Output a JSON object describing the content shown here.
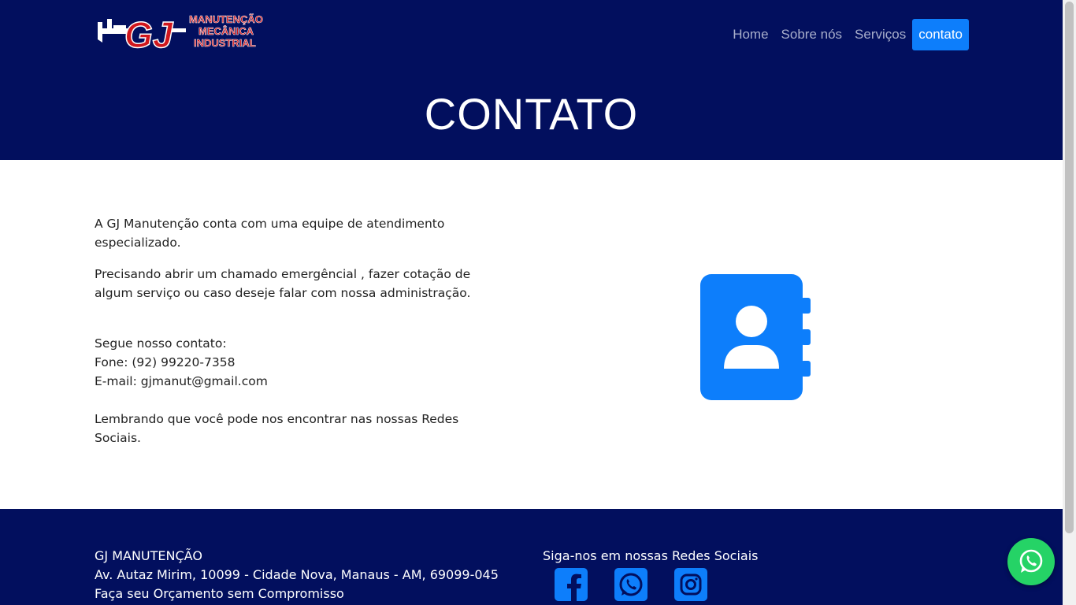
{
  "logo": {
    "initials": "GJ",
    "line1": "MANUTENÇÃO",
    "line2": "MECÂNICA",
    "line3": "INDUSTRIAL"
  },
  "nav": {
    "items": [
      {
        "label": "Home"
      },
      {
        "label": "Sobre nós"
      },
      {
        "label": "Serviços"
      },
      {
        "label": "contato"
      }
    ]
  },
  "hero": {
    "title": "CONTATO"
  },
  "content": {
    "p1": "A GJ Manutenção conta com uma equipe de atendimento especializado.",
    "p2": "Precisando abrir um chamado emergêncial , fazer cotação de algum serviço ou caso deseje falar com nossa administração.",
    "contact_intro": "Segue nosso contato:",
    "phone": "Fone: (92) 99220-7358",
    "email": "E-mail: gjmanut@gmail.com",
    "social_note": "Lembrando que você pode nos encontrar nas nossas Redes Sociais."
  },
  "footer": {
    "company": "GJ MANUTENÇÃO",
    "address": "Av. Autaz Mirim, 10099 - Cidade Nova, Manaus - AM, 69099-045",
    "tagline": "Faça seu Orçamento sem Compromisso",
    "social_title": "Siga-nos em nossas Redes Sociais"
  },
  "colors": {
    "navy": "#020f5e",
    "accent": "#0d7efb",
    "whatsapp": "#25d366",
    "logo_red": "#d0171d"
  },
  "icons": [
    "contact-book-icon",
    "facebook-icon",
    "whatsapp-icon",
    "instagram-icon",
    "whatsapp-float-icon"
  ]
}
